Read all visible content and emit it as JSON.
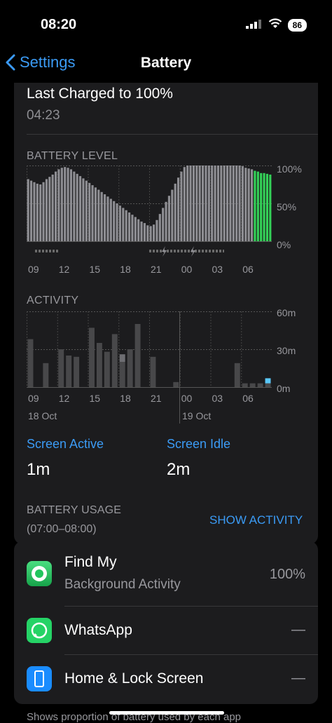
{
  "status": {
    "time": "08:20",
    "battery": "86"
  },
  "nav": {
    "back_label": "Settings",
    "title": "Battery"
  },
  "last_charged": {
    "title": "Last Charged to 100%",
    "time": "04:23"
  },
  "battery_level": {
    "label": "BATTERY LEVEL",
    "y_ticks": [
      "100%",
      "50%",
      "0%"
    ],
    "x_ticks": [
      "09",
      "12",
      "15",
      "18",
      "21",
      "00",
      "03",
      "06"
    ]
  },
  "activity": {
    "label": "ACTIVITY",
    "y_ticks": [
      "60m",
      "30m",
      "0m"
    ],
    "x_ticks": [
      "09",
      "12",
      "15",
      "18",
      "21",
      "00",
      "03",
      "06"
    ],
    "dates": [
      "18 Oct",
      "19 Oct"
    ]
  },
  "metrics": {
    "screen_active_label": "Screen Active",
    "screen_active_value": "1m",
    "screen_idle_label": "Screen Idle",
    "screen_idle_value": "2m"
  },
  "usage": {
    "header": "BATTERY USAGE",
    "period": "(07:00–08:00)",
    "show_activity": "SHOW ACTIVITY"
  },
  "apps": [
    {
      "name": "Find My",
      "sub": "Background Activity",
      "value": "100%"
    },
    {
      "name": "WhatsApp",
      "sub": "",
      "value": "—"
    },
    {
      "name": "Home & Lock Screen",
      "sub": "",
      "value": "—"
    }
  ],
  "footer": "Shows proportion of battery used by each app",
  "chart_data": [
    {
      "type": "bar",
      "title": "BATTERY LEVEL",
      "ylim": [
        0,
        100
      ],
      "y_ticks": [
        "100%",
        "50%",
        "0%"
      ],
      "x_ticks": [
        "09",
        "12",
        "15",
        "18",
        "21",
        "00",
        "03",
        "06"
      ],
      "values": [
        82,
        80,
        78,
        76,
        75,
        78,
        82,
        85,
        88,
        92,
        95,
        97,
        98,
        97,
        95,
        92,
        89,
        86,
        83,
        80,
        77,
        74,
        71,
        68,
        65,
        62,
        59,
        56,
        53,
        50,
        47,
        44,
        41,
        38,
        35,
        32,
        29,
        26,
        24,
        21,
        20,
        22,
        28,
        36,
        44,
        52,
        60,
        68,
        76,
        84,
        92,
        98,
        100,
        100,
        100,
        100,
        100,
        100,
        100,
        100,
        100,
        100,
        100,
        100,
        100,
        100,
        100,
        100,
        100,
        100,
        99,
        97,
        96,
        95,
        93,
        92,
        90,
        90,
        89,
        88
      ],
      "charging_from_index": 74
    },
    {
      "type": "bar",
      "title": "ACTIVITY",
      "ylim": [
        0,
        60
      ],
      "y_ticks": [
        "60m",
        "30m",
        "0m"
      ],
      "x_ticks": [
        "09",
        "12",
        "15",
        "18",
        "21",
        "00",
        "03",
        "06"
      ],
      "series": [
        {
          "name": "Screen Active",
          "values": [
            38,
            0,
            19,
            0,
            30,
            25,
            24,
            0,
            47,
            35,
            28,
            42,
            20,
            30,
            50,
            0,
            24,
            0,
            0,
            4,
            0,
            0,
            0,
            0,
            0,
            0,
            0,
            19,
            3,
            3,
            3,
            3
          ]
        },
        {
          "name": "Screen Idle",
          "values": [
            0,
            0,
            0,
            0,
            0,
            0,
            0,
            0,
            0,
            0,
            0,
            0,
            6,
            0,
            0,
            0,
            0,
            0,
            0,
            0,
            0,
            0,
            0,
            0,
            0,
            0,
            0,
            0,
            0,
            0,
            0,
            4
          ]
        }
      ]
    }
  ]
}
